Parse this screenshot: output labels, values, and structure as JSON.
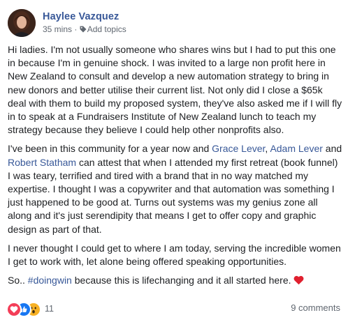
{
  "post": {
    "author": "Haylee Vazquez",
    "time": "35 mins",
    "separator": "·",
    "add_topics": "Add topics",
    "paragraphs": [
      [
        {
          "text": "Hi ladies. I'm not usually someone who shares wins but I had to put this one in because I'm in genuine shock. I was invited to a large non profit here in New Zealand to consult and develop a new automation strategy to bring in new donors and better utilise their current list. Not only did I close a $65k deal with them to build my proposed system, they've also asked me if I will fly in to speak at a Fundraisers Institute of New Zealand lunch to teach my strategy because they believe I could help other nonprofits also."
        }
      ],
      [
        {
          "text": "I've been in this community for a year now and "
        },
        {
          "text": "Grace Lever",
          "link": true
        },
        {
          "text": ", "
        },
        {
          "text": "Adam Lever",
          "link": true
        },
        {
          "text": " and "
        },
        {
          "text": "Robert Statham",
          "link": true
        },
        {
          "text": " can attest that when I attended my first retreat (book funnel) I was teary, terrified and tired with a brand that in no way matched my expertise. I thought I was a copywriter and that automation was something I just happened to be good at. Turns out systems was my genius zone all along and it's just serendipity that means I get to offer copy and graphic design as part of that."
        }
      ],
      [
        {
          "text": "I never thought I could get to where I am today, serving the incredible women I get to work with, let alone being offered speaking opportunities."
        }
      ],
      [
        {
          "text": "So.. "
        },
        {
          "text": "#doingwin",
          "link": true
        },
        {
          "text": " because this is lifechanging and it all started here."
        }
      ]
    ],
    "reactions": {
      "count": "11",
      "icons": [
        "love-reaction-icon",
        "like-reaction-icon",
        "wow-reaction-icon"
      ]
    },
    "comments": "9 comments"
  },
  "colors": {
    "link": "#385898",
    "text": "#1c1e21",
    "muted": "#606770",
    "love": "#f33e58",
    "like": "#1877f2",
    "wow": "#f7b125"
  }
}
